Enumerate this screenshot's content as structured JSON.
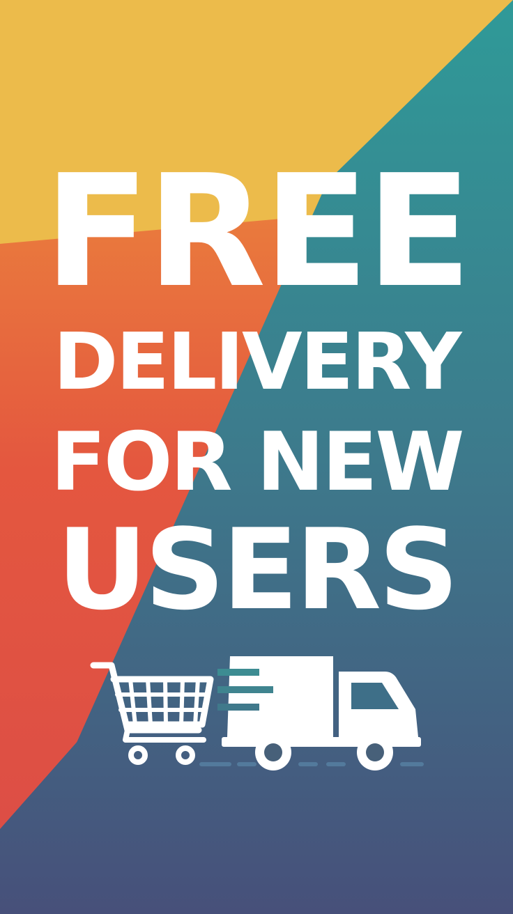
{
  "headline": {
    "line1": "FREE",
    "line2": "DELIVERY",
    "line3": "FOR NEW",
    "line4": "USERS"
  },
  "icons": {
    "cart": "shopping-cart-icon",
    "truck": "delivery-truck-icon"
  },
  "colors": {
    "yellow": "#ecbb4b",
    "orange": "#e8683f",
    "red": "#dc4e44",
    "teal": "#2f9797",
    "navy": "#46557a",
    "text": "#ffffff"
  }
}
